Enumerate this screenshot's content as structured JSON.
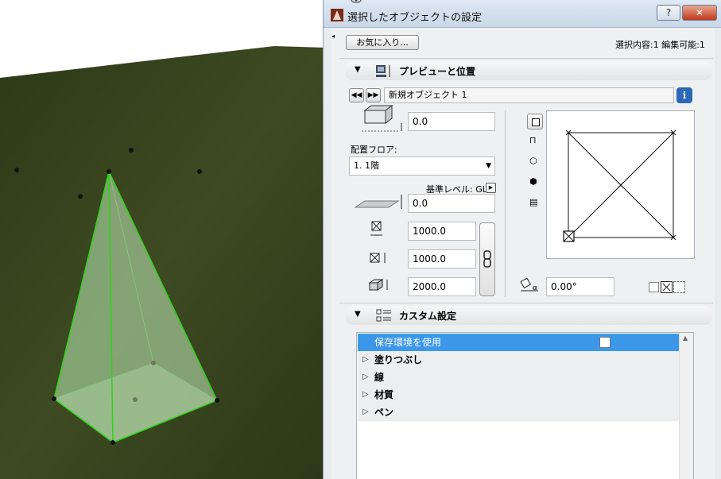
{
  "dialog": {
    "title": "選択したオブジェクトの設定",
    "help_label": "?",
    "close_label": "✕",
    "favorites_label": "お気に入り...",
    "selection_info": "選択内容:1 編集可能:1"
  },
  "preview_section": {
    "title": "プレビューと位置",
    "object_name": "新規オブジェクト 1",
    "elevation_value": "0.0",
    "floor_label": "配置フロア:",
    "floor_value": "1. 1階",
    "reference_level_label": "基準レベル: GL",
    "offset_value": "0.0",
    "width_value": "1000.0",
    "depth_value": "1000.0",
    "height_value": "2000.0",
    "angle_value": "0.00°"
  },
  "custom_section": {
    "title": "カスタム設定",
    "rows": [
      {
        "label": "保存環境を使用",
        "selected": true,
        "has_checkbox": true
      },
      {
        "label": "塗りつぶし"
      },
      {
        "label": "線"
      },
      {
        "label": "材質"
      },
      {
        "label": "ペン"
      }
    ]
  },
  "colors": {
    "accent_selection": "#3c97e8",
    "ground": "#39451f",
    "pyramid_edge": "#2fd21a"
  },
  "icons": [
    "app-icon",
    "eye-icon",
    "prev-arrow-icon",
    "next-arrow-icon",
    "info-icon",
    "elevation-icon",
    "offset-icon",
    "width-icon",
    "depth-icon",
    "height-icon",
    "chain-link-icon",
    "plan-view-icon",
    "section-view-icon",
    "3d-view-icon",
    "3d-shaded-icon",
    "film-icon",
    "angle-icon",
    "mirror-checkbox",
    "custom-settings-icon",
    "preview-icon"
  ]
}
